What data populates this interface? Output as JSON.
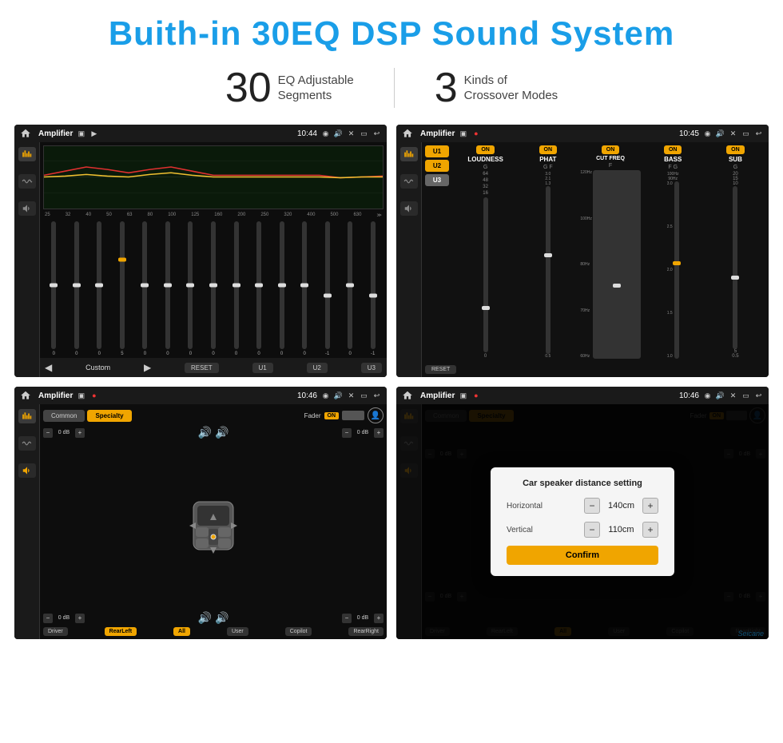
{
  "page": {
    "title": "Buith-in 30EQ DSP Sound System",
    "stat1_number": "30",
    "stat1_text_line1": "EQ Adjustable",
    "stat1_text_line2": "Segments",
    "stat2_number": "3",
    "stat2_text_line1": "Kinds of",
    "stat2_text_line2": "Crossover Modes"
  },
  "screen1": {
    "app_name": "Amplifier",
    "time": "10:44",
    "eq_labels": [
      "25",
      "32",
      "40",
      "50",
      "63",
      "80",
      "100",
      "125",
      "160",
      "200",
      "250",
      "320",
      "400",
      "500",
      "630"
    ],
    "eq_values": [
      "0",
      "0",
      "0",
      "5",
      "0",
      "0",
      "0",
      "0",
      "0",
      "0",
      "0",
      "0",
      "-1",
      "0",
      "-1"
    ],
    "btn_reset": "RESET",
    "btn_u1": "U1",
    "btn_u2": "U2",
    "btn_u3": "U3",
    "label_custom": "Custom"
  },
  "screen2": {
    "app_name": "Amplifier",
    "time": "10:45",
    "preset_u1": "U1",
    "preset_u2": "U2",
    "preset_u3": "U3",
    "channels": [
      "LOUDNESS",
      "PHAT",
      "CUT FREQ",
      "BASS",
      "SUB"
    ],
    "channel_on": [
      "ON",
      "ON",
      "ON",
      "ON",
      "ON"
    ],
    "sub_labels": [
      "G",
      "G F",
      "F",
      "F G",
      "G"
    ],
    "btn_reset": "RESET"
  },
  "screen3": {
    "app_name": "Amplifier",
    "time": "10:46",
    "tab_common": "Common",
    "tab_specialty": "Specialty",
    "fader_label": "Fader",
    "on_label": "ON",
    "speaker_controls": [
      {
        "label": "0 dB"
      },
      {
        "label": "0 dB"
      },
      {
        "label": "0 dB"
      },
      {
        "label": "0 dB"
      }
    ],
    "btn_driver": "Driver",
    "btn_rearleft": "RearLeft",
    "btn_all": "All",
    "btn_user": "User",
    "btn_copilot": "Copilot",
    "btn_rearright": "RearRight"
  },
  "screen4": {
    "app_name": "Amplifier",
    "time": "10:46",
    "tab_common": "Common",
    "tab_specialty": "Specialty",
    "on_label": "ON",
    "btn_driver": "Driver",
    "btn_rearleft": "RearLeft",
    "btn_user": "User",
    "btn_copilot": "Copilot",
    "btn_rearright": "RearRight",
    "dialog_title": "Car speaker distance setting",
    "horizontal_label": "Horizontal",
    "horizontal_value": "140cm",
    "vertical_label": "Vertical",
    "vertical_value": "110cm",
    "btn_confirm": "Confirm",
    "sp_0db_1": "0 dB",
    "sp_0db_2": "0 dB"
  },
  "watermark": "Seicane"
}
